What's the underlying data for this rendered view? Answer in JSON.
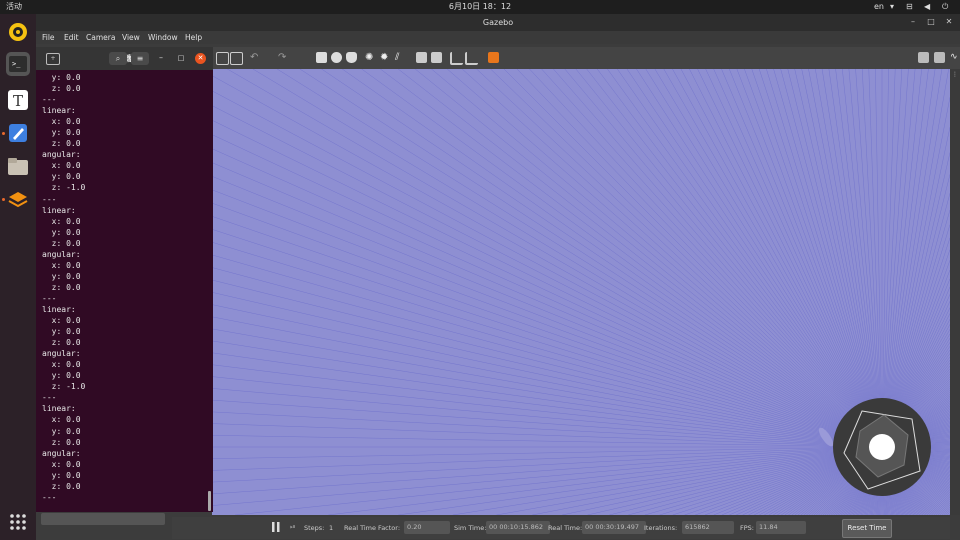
{
  "topbar": {
    "activities": "活动",
    "clock": "6月10日  18：12",
    "lang": "en"
  },
  "gazebo": {
    "title": "Gazebo",
    "menu": [
      "File",
      "Edit",
      "Camera",
      "View",
      "Window",
      "Help"
    ],
    "bottom": {
      "steps_label": "Steps:",
      "steps_value": "1",
      "rtf_label": "Real Time Factor:",
      "rtf_value": "0.20",
      "sim_time_label": "Sim Time:",
      "sim_time_value": "00 00:10:15.862",
      "real_time_label": "Real Time:",
      "real_time_value": "00 00:30:19.497",
      "iterations_label": "Iterations:",
      "iterations_value": "615862",
      "fps_label": "FPS:",
      "fps_value": "11.84",
      "reset_label": "Reset Time"
    },
    "colors": {
      "viewport": "#8e8fd2",
      "laser": "#5a5cc8"
    }
  },
  "terminal": {
    "title": "终端",
    "lines": [
      "  y: 0.0",
      "  z: 0.0",
      "---",
      "linear:",
      "  x: 0.0",
      "  y: 0.0",
      "  z: 0.0",
      "angular:",
      "  x: 0.0",
      "  y: 0.0",
      "  z: -1.0",
      "---",
      "linear:",
      "  x: 0.0",
      "  y: 0.0",
      "  z: 0.0",
      "angular:",
      "  x: 0.0",
      "  y: 0.0",
      "  z: 0.0",
      "---",
      "linear:",
      "  x: 0.0",
      "  y: 0.0",
      "  z: 0.0",
      "angular:",
      "  x: 0.0",
      "  y: 0.0",
      "  z: -1.0",
      "---",
      "linear:",
      "  x: 0.0",
      "  y: 0.0",
      "  z: 0.0",
      "angular:",
      "  x: 0.0",
      "  y: 0.0",
      "  z: 0.0",
      "---"
    ]
  },
  "dock": {
    "items": [
      "rhythmbox-icon",
      "terminal-icon",
      "text-editor-icon",
      "notes-icon",
      "files-icon",
      "layers-icon",
      "app-grid-icon"
    ]
  }
}
